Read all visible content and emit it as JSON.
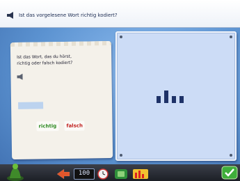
{
  "header": {
    "instruction": "Ist das vorgelesene Wort richtig kodiert?"
  },
  "card": {
    "question_line1": "Ist das Wort, das du hörst,",
    "question_line2": "richtig oder falsch kodiert?",
    "answer_value": "",
    "richtig_label": "richtig",
    "falsch_label": "falsch"
  },
  "display": {
    "bars": [
      {
        "level": 0.55
      },
      {
        "level": 1.0
      },
      {
        "level": 0.55
      },
      {
        "level": 0.55
      }
    ]
  },
  "toolbar": {
    "counter": "100"
  },
  "colors": {
    "accent_blue": "#5c93d1",
    "richtig_green": "#2d8a22",
    "falsch_red": "#c0201e",
    "bar_navy": "#1e3268"
  }
}
